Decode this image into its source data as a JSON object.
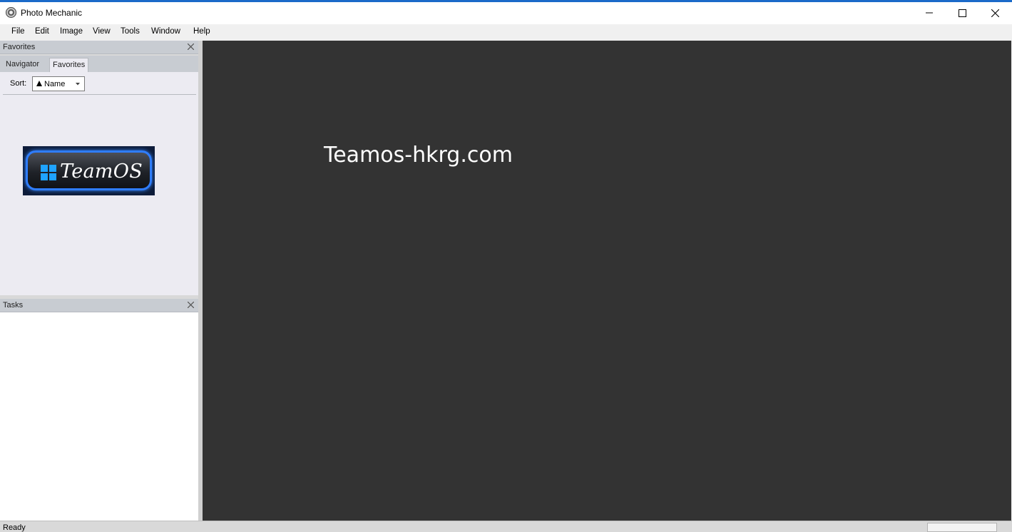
{
  "window": {
    "title": "Photo Mechanic",
    "app_icon": "camera-aperture-icon"
  },
  "menu": [
    "File",
    "Edit",
    "Image",
    "View",
    "Tools",
    "Window",
    "Help"
  ],
  "favorites_panel": {
    "title": "Favorites",
    "tabs": [
      "Navigator",
      "Favorites"
    ],
    "active_tab": "Favorites",
    "sort": {
      "label": "Sort:",
      "value": "Name",
      "direction_icon": "sort-ascending-icon"
    },
    "logo_text": "TeamOS"
  },
  "tasks_panel": {
    "title": "Tasks"
  },
  "main": {
    "watermark": "Teamos-hkrg.com"
  },
  "status": {
    "text": "Ready"
  },
  "colors": {
    "accent": "#1b6ac9",
    "main_bg": "#333333",
    "panel_bg": "#ecebf2",
    "header_bg": "#c8ccd2"
  }
}
